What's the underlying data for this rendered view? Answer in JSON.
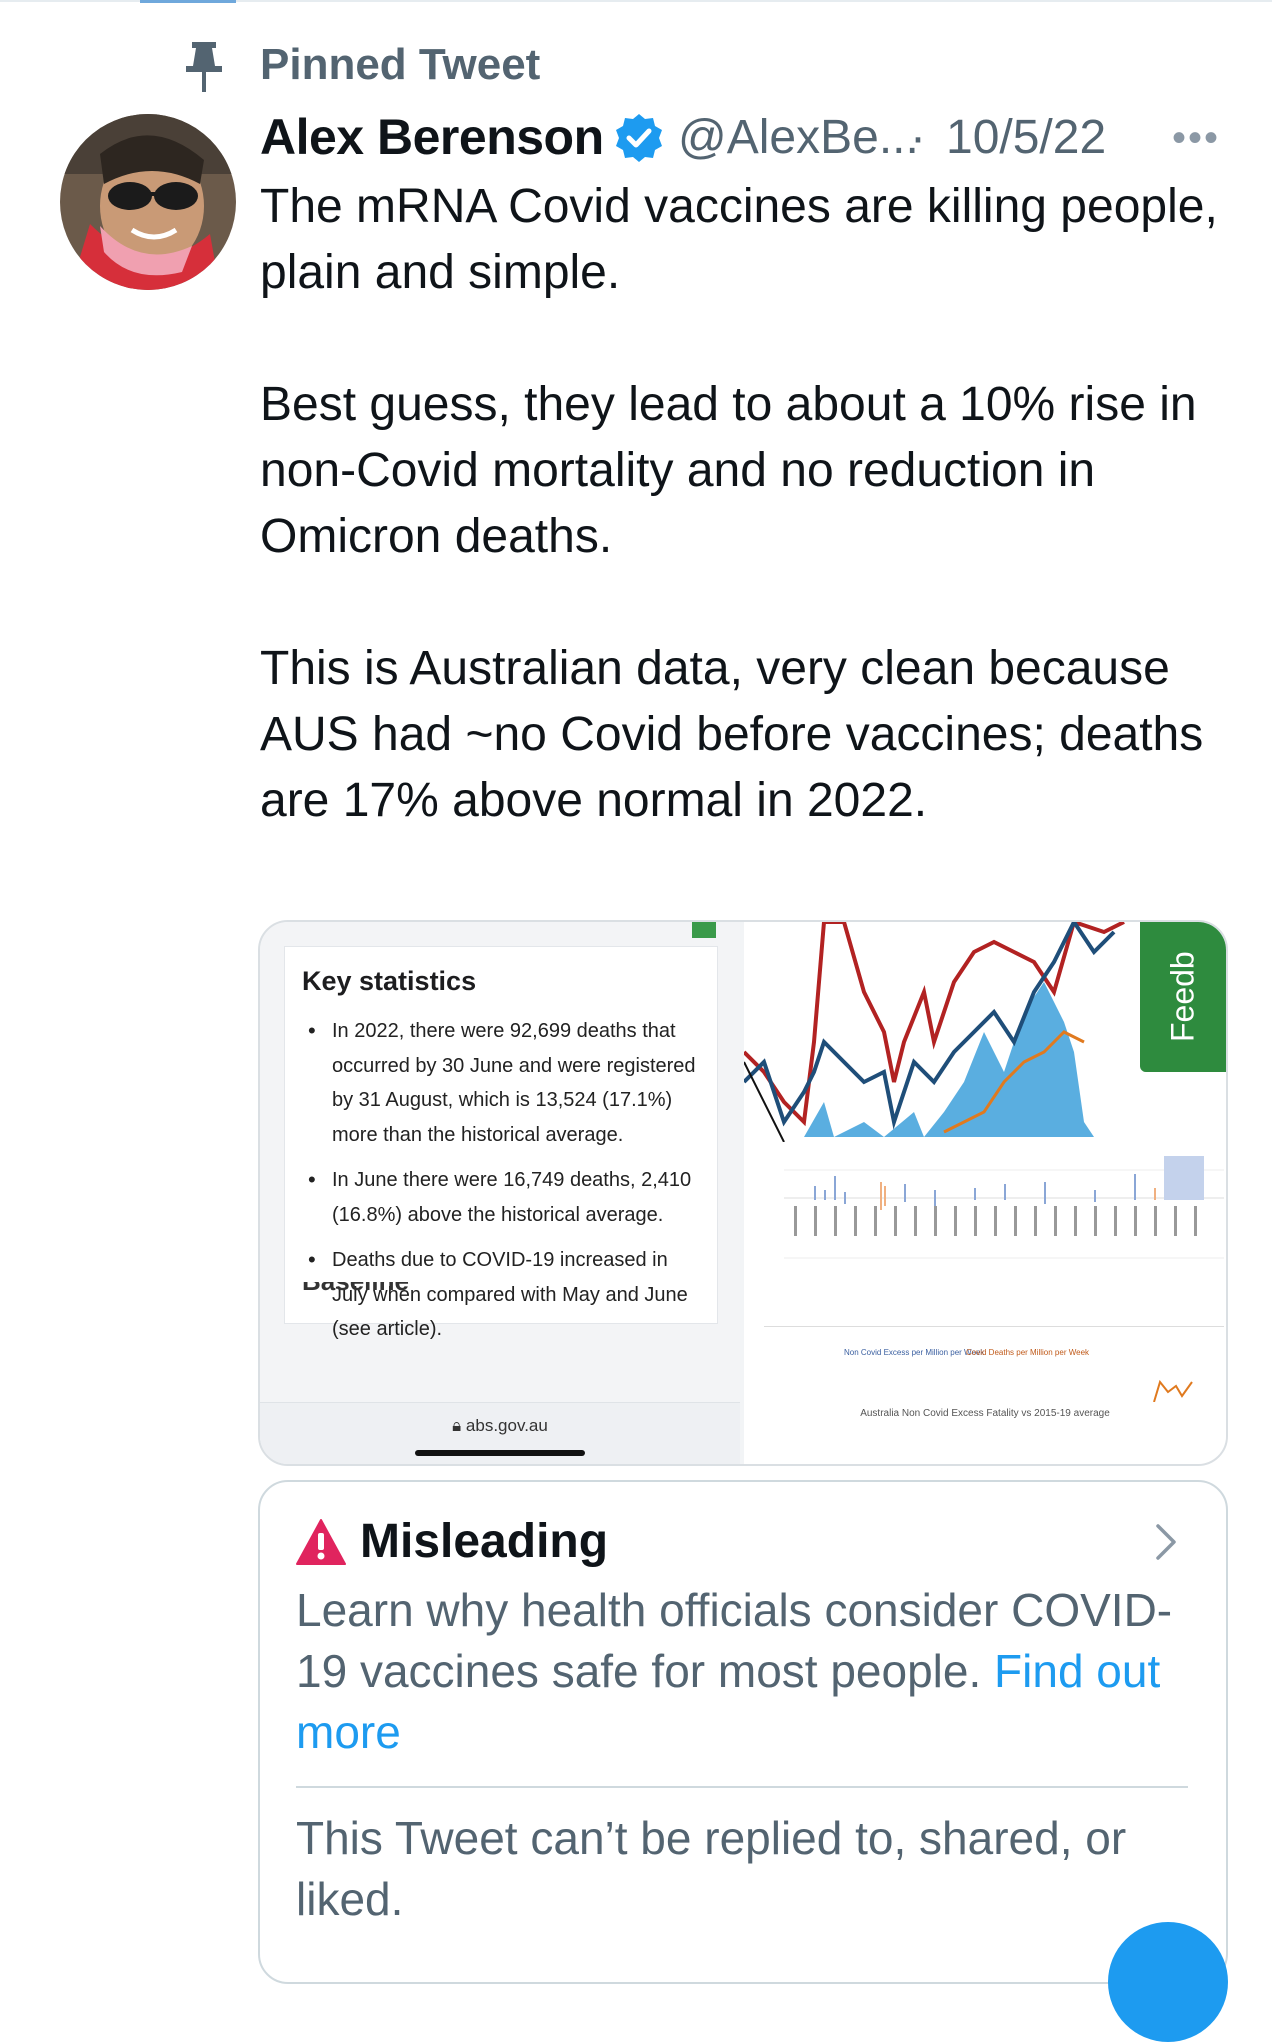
{
  "pinned": {
    "label": "Pinned Tweet",
    "icon": "pin-icon"
  },
  "tweet": {
    "author_name": "Alex Berenson",
    "handle": "@AlexBe...",
    "separator": "·",
    "date": "10/5/22",
    "verified_icon": "verified-badge-icon",
    "more_icon": "more-options-icon",
    "more_glyph": "•••",
    "text": "The mRNA Covid vaccines are killing people, plain and simple.\n\nBest guess, they lead to about a 10% rise in non-Covid mortality and no reduction in Omicron deaths.\n\nThis is Australian data, very clean because AUS had ~no Covid before vaccines; deaths are 17% above normal in 2022."
  },
  "media": {
    "left": {
      "card_title": "Key statistics",
      "bullets": [
        "In 2022, there were 92,699 deaths that occurred by 30 June and were registered by 31 August, which is 13,524 (17.1%) more than the historical average.",
        "In June there were 16,749 deaths, 2,410 (16.8%) above the historical average.",
        "Deaths due to COVID-19 increased in July when compared with May and June (see article)."
      ],
      "cut_off_heading": "Baseline comparisons",
      "url": "abs.gov.au",
      "lock_icon": "lock-icon"
    },
    "right": {
      "feedback_label": "Feedb",
      "legend_1": "Non Covid Excess per Million per Week",
      "legend_2": "Covid Deaths per Million per Week",
      "caption": "Australia Non Covid Excess Fatality vs 2015-19 average",
      "colors": {
        "red": "#b22222",
        "navy": "#1f4e79",
        "blue_band": "#5aaee0",
        "orange": "#e07a1f"
      }
    }
  },
  "notice": {
    "icon": "warning-icon",
    "title": "Misleading",
    "body": "Learn why health officials consider COVID-19 vaccines safe for most people.",
    "link": "Find out more",
    "chevron_icon": "chevron-right-icon",
    "no_reply": "This Tweet can’t be replied to, shared, or liked."
  },
  "colors": {
    "accent": "#1d9bf0",
    "muted": "#536471",
    "warning": "#e0245e"
  }
}
